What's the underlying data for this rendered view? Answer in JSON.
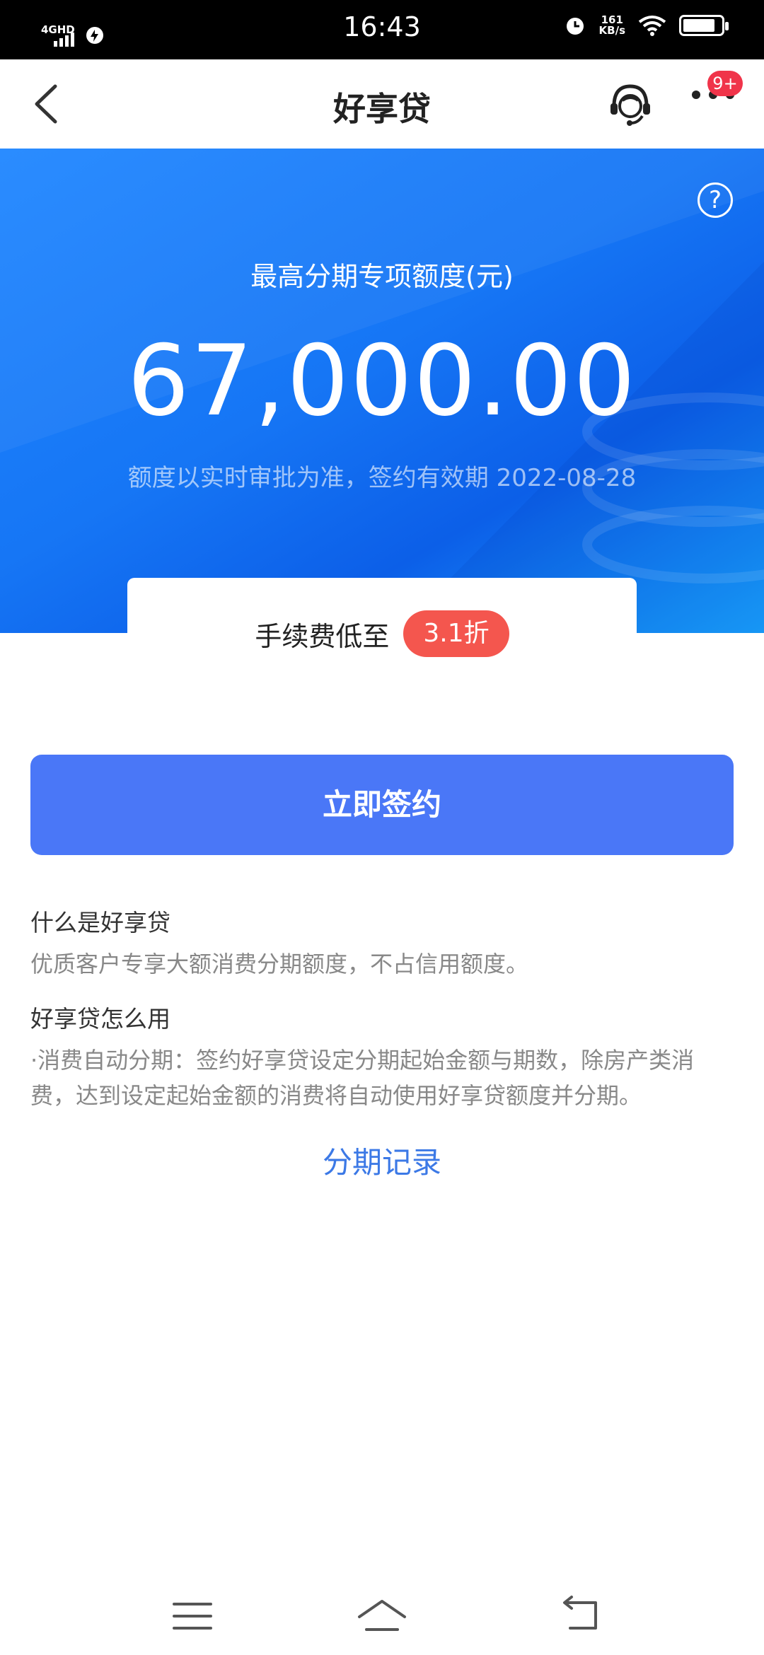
{
  "status_bar": {
    "network": "4GHD",
    "time": "16:43",
    "speed_value": "161",
    "speed_unit": "KB/s"
  },
  "header": {
    "title": "好享贷",
    "badge": "9+"
  },
  "hero": {
    "help_glyph": "?",
    "label": "最高分期专项额度(元)",
    "amount": "67,000.00",
    "note": "额度以实时审批为准，签约有效期 2022-08-28"
  },
  "fee": {
    "text": "手续费低至",
    "tag": "3.1折"
  },
  "actions": {
    "sign_label": "立即签约",
    "record_label": "分期记录"
  },
  "info": {
    "q1": "什么是好享贷",
    "a1": "优质客户专享大额消费分期额度，不占信用额度。",
    "q2": "好享贷怎么用",
    "a2": "·消费自动分期：签约好享贷设定分期起始金额与期数，除房产类消费，达到设定起始金额的消费将自动使用好享贷额度并分期。"
  },
  "icons": {
    "back": "chevron-left-icon",
    "service": "customer-service-icon",
    "more": "more-dots-icon",
    "help": "help-circle-icon",
    "menu": "menu-icon",
    "home": "home-icon",
    "return": "return-icon"
  },
  "colors": {
    "primary": "#4a77f7",
    "hero_blue": "#1676f5",
    "tag_red": "#f4564e",
    "link_blue": "#3c79e6",
    "badge_red": "#f0344a"
  }
}
